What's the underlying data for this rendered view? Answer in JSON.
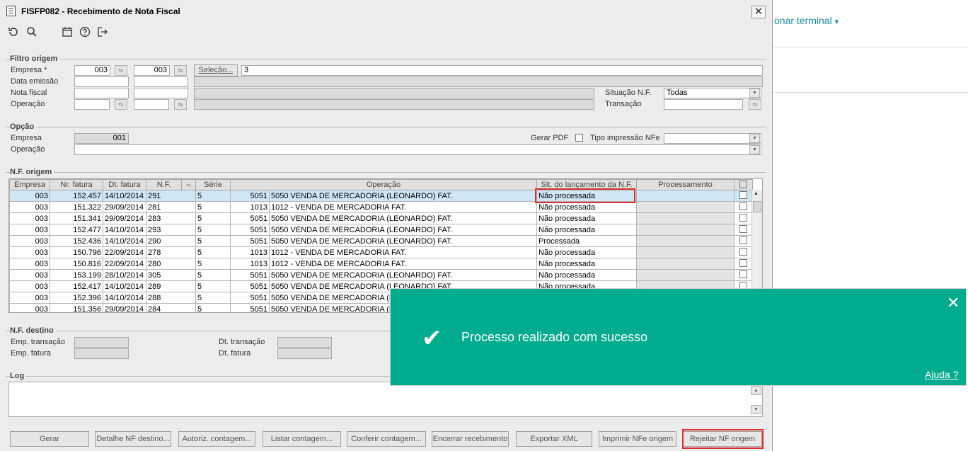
{
  "background": {
    "link_text": "onar terminal",
    "link_caret": "▾"
  },
  "window": {
    "title": "FISFP082 - Recebimento de Nota Fiscal",
    "close": "✕",
    "toolbar": [
      "refresh-icon",
      "search-icon",
      "calendar-icon",
      "help-icon",
      "exit-icon"
    ]
  },
  "filtro": {
    "title": "Filtro origem",
    "empresa_label": "Empresa *",
    "empresa_from": "003",
    "empresa_to": "003",
    "selecao_label": "Seleção...",
    "selecao_value": "3",
    "data_label": "Data emissão",
    "nota_label": "Nota fiscal",
    "operacao_label": "Operação",
    "situacao_label": "Situação N.F.",
    "situacao_value": "Todas",
    "transacao_label": "Transação"
  },
  "opcao": {
    "title": "Opção",
    "empresa_label": "Empresa",
    "empresa_value": "001",
    "operacao_label": "Operação",
    "gerar_pdf_label": "Gerar PDF",
    "tipo_label": "Tipo impressão NFe"
  },
  "nf": {
    "title": "N.F. origem",
    "headers": [
      "Empresa",
      "Nr. fatura",
      "Dt. fatura",
      "N.F.",
      "",
      "Série",
      "Operação",
      "Sit. do lançamento da N.F.",
      "Processamento",
      ""
    ],
    "rows": [
      [
        "003",
        "152.457",
        "14/10/2014",
        "291",
        "5",
        "5051",
        "5050 VENDA DE MERCADORIA (LEONARDO) FAT.",
        "Não processada"
      ],
      [
        "003",
        "151.322",
        "29/09/2014",
        "281",
        "5",
        "1013",
        "1012 - VENDA DE MERCADORIA FAT.",
        "Não processada"
      ],
      [
        "003",
        "151.341",
        "29/09/2014",
        "283",
        "5",
        "5051",
        "5050 VENDA DE MERCADORIA (LEONARDO) FAT.",
        "Não processada"
      ],
      [
        "003",
        "152.477",
        "14/10/2014",
        "293",
        "5",
        "5051",
        "5050 VENDA DE MERCADORIA (LEONARDO) FAT.",
        "Não processada"
      ],
      [
        "003",
        "152.436",
        "14/10/2014",
        "290",
        "5",
        "5051",
        "5050 VENDA DE MERCADORIA (LEONARDO) FAT.",
        "Processada"
      ],
      [
        "003",
        "150.796",
        "22/09/2014",
        "278",
        "5",
        "1013",
        "1012 - VENDA DE MERCADORIA FAT.",
        "Não processada"
      ],
      [
        "003",
        "150.816",
        "22/09/2014",
        "280",
        "5",
        "1013",
        "1012 - VENDA DE MERCADORIA FAT.",
        "Não processada"
      ],
      [
        "003",
        "153.199",
        "28/10/2014",
        "305",
        "5",
        "5051",
        "5050 VENDA DE MERCADORIA (LEONARDO) FAT.",
        "Não processada"
      ],
      [
        "003",
        "152.417",
        "14/10/2014",
        "289",
        "5",
        "5051",
        "5050 VENDA DE MERCADORIA (LEONARDO) FAT.",
        "Não processada"
      ],
      [
        "003",
        "152.396",
        "14/10/2014",
        "288",
        "5",
        "5051",
        "5050 VENDA DE MERCADORIA (LEC",
        ""
      ],
      [
        "003",
        "151.356",
        "29/09/2014",
        "284",
        "5",
        "5051",
        "5050 VENDA DE MERCADORIA (LEC",
        ""
      ]
    ]
  },
  "destino": {
    "title": "N.F. destino",
    "emp_transacao": "Emp. transação",
    "emp_fatura": "Emp. fatura",
    "dt_transacao": "Dt. transação",
    "dt_fatura": "Dt. fatura"
  },
  "log": {
    "title": "Log"
  },
  "buttons": [
    "Gerar",
    "Detalhe NF destino...",
    "Autoriz. contagem...",
    "Listar contagem...",
    "Conferir contagem...",
    "Encerrar recebimento",
    "Exportar XML",
    "Imprimir NFe origem",
    "Rejeitar NF origem"
  ],
  "toast": {
    "message": "Processo realizado com sucesso",
    "help": "Ajuda ?",
    "close": "✕",
    "check": "✔",
    "color": "#00ab8e"
  },
  "colors": {
    "highlight": "#d9302c",
    "selected_row": "#cfe6f7"
  }
}
